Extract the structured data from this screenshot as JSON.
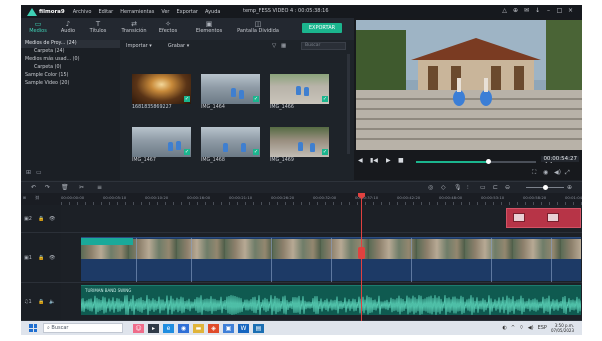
{
  "app": {
    "brand": "filmora9",
    "menu": [
      "Archivo",
      "Editar",
      "Herramientas",
      "Ver",
      "Exportar",
      "Ayuda"
    ],
    "window_title": "temp_FESS VIDEO 4 : 00:05:38:16"
  },
  "media_tabs": [
    {
      "label": "Medios",
      "icon": "folder-icon",
      "active": true
    },
    {
      "label": "Audio",
      "icon": "music-note-icon",
      "active": false
    },
    {
      "label": "Títulos",
      "icon": "text-icon",
      "active": false
    },
    {
      "label": "Transición",
      "icon": "transition-icon",
      "active": false
    },
    {
      "label": "Efectos",
      "icon": "effects-icon",
      "active": false
    },
    {
      "label": "Elementos",
      "icon": "elements-icon",
      "active": false
    },
    {
      "label": "Pantalla Dividida",
      "icon": "split-screen-icon",
      "active": false
    }
  ],
  "export_label": "EXPORTAR",
  "library": [
    {
      "label": "Medios de Proy... (24)",
      "sub": false,
      "selected": true
    },
    {
      "label": "Carpeta (24)",
      "sub": true,
      "selected": false
    },
    {
      "label": "Medios más usad... (0)",
      "sub": false,
      "selected": false
    },
    {
      "label": "Carpeta (0)",
      "sub": true,
      "selected": false
    },
    {
      "label": "Sample Color (15)",
      "sub": false,
      "selected": false
    },
    {
      "label": "Sample Video (20)",
      "sub": false,
      "selected": false
    }
  ],
  "grid_toolbar": {
    "import_label": "Importar",
    "record_label": "Grabar",
    "search_placeholder": "Buscar"
  },
  "media_items": [
    {
      "name": "1681835869227",
      "kind": "hall"
    },
    {
      "name": "IMG_1464",
      "kind": "dance1"
    },
    {
      "name": "IMG_1466",
      "kind": "dance2"
    },
    {
      "name": "IMG_1467",
      "kind": "dance1"
    },
    {
      "name": "IMG_1468",
      "kind": "dance1"
    },
    {
      "name": "IMG_1469",
      "kind": "steps"
    }
  ],
  "preview": {
    "time": "00:00:54:27",
    "progress": 0.6
  },
  "timeline": {
    "ruler_ticks": [
      "00:00:00:00",
      "00:00:05:10",
      "00:00:10:20",
      "00:00:16:00",
      "00:00:21:10",
      "00:00:26:20",
      "00:00:32:00",
      "00:00:37:10",
      "00:00:42:20",
      "00:00:48:00",
      "00:00:53:10",
      "00:00:58:20",
      "00:01:04:00"
    ],
    "track_labels": {
      "overlay": "2",
      "video": "1",
      "audio": "1"
    },
    "audio_clip_name": "TURIMAN BAND SWING"
  },
  "taskbar": {
    "search_placeholder": "Buscar",
    "lang": "ESP",
    "time": "3:50 p.m.",
    "date": "07/05/2023"
  }
}
